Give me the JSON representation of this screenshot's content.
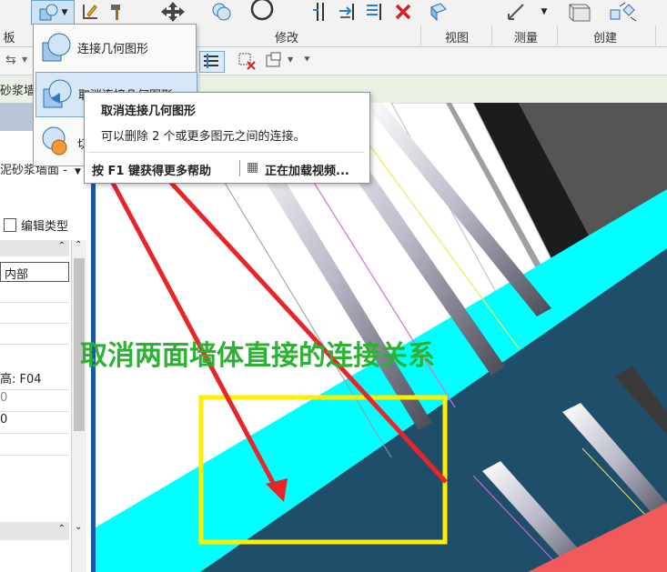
{
  "ribbon": {
    "groups": [
      {
        "label": "板"
      },
      {
        "label": "修改"
      },
      {
        "label": "视图"
      },
      {
        "label": "测量"
      },
      {
        "label": "创建"
      }
    ]
  },
  "dropdown": {
    "items": [
      {
        "label": "连接几何图形"
      },
      {
        "label": "取消连接几何图形"
      },
      {
        "label": "切换连接顺序"
      }
    ]
  },
  "tooltip": {
    "title": "取消连接几何图形",
    "description": "可以删除 2 个或更多图元之间的连接。",
    "help": "按 F1 键获得更多帮助",
    "video": "正在加载视频..."
  },
  "options_bar": {
    "wall_label": "砂浆墙面"
  },
  "properties": {
    "type_selector": "泥砂浆墙面 -",
    "edit_type": "编辑类型",
    "rows": [
      "内部",
      "",
      "",
      "",
      "高: F04",
      "0",
      "0",
      "",
      ""
    ]
  },
  "annotation": {
    "text": "取消两面墙体直接的连接关系"
  },
  "colors": {
    "arrow": "#e8262a",
    "highlight_box": "#ffee00",
    "annotation_text": "#2cb232",
    "wall_cyan": "#00ffff",
    "wall_dark": "#1f4e6b",
    "accent_red": "#f05a5a"
  }
}
